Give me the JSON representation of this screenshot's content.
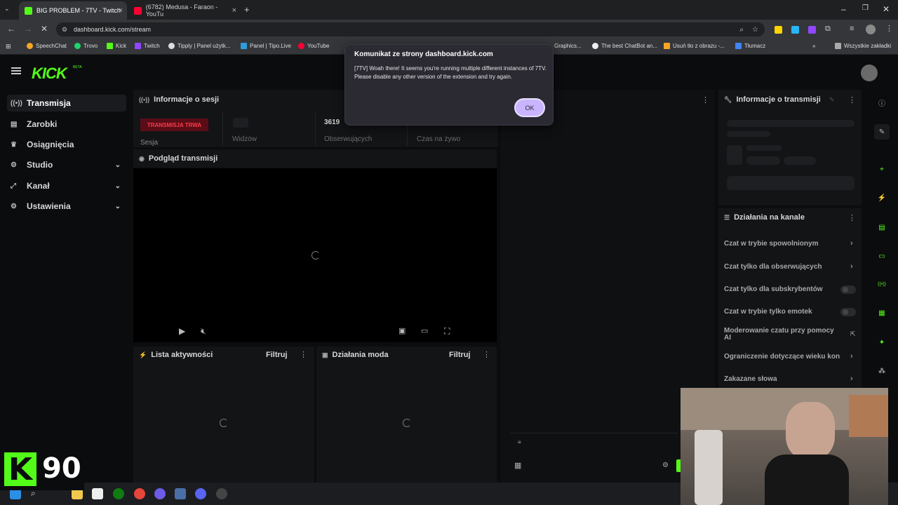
{
  "browser": {
    "tabs": [
      {
        "title": "BIG PROBLEM - 7TV - Twitch",
        "active": true
      },
      {
        "title": "(6782) Medusa - Faraon - YouTu",
        "active": false
      }
    ],
    "url": "dashboard.kick.com/stream",
    "bookmarks": [
      "SpeechChat",
      "Trovo",
      "Kick",
      "Twitch",
      "Tipply | Panel użytk...",
      "Panel | Tipo.Live",
      "YouTube",
      "Graphics...",
      "The best ChatBot an...",
      "Usuń tło z obrazu -...",
      "Tłumacz"
    ],
    "bookmarks_folder": "Wszystkie zakładki"
  },
  "kick": {
    "logo": "KICK",
    "beta": "BETA",
    "sidebar": [
      {
        "label": "Transmisja",
        "icon": "broadcast-icon",
        "active": true
      },
      {
        "label": "Zarobki",
        "icon": "wallet-icon"
      },
      {
        "label": "Osiągnięcia",
        "icon": "trophy-icon"
      },
      {
        "label": "Studio",
        "icon": "studio-icon",
        "expandable": true
      },
      {
        "label": "Kanał",
        "icon": "channel-icon",
        "expandable": true
      },
      {
        "label": "Ustawienia",
        "icon": "gear-icon",
        "expandable": true
      }
    ],
    "session": {
      "title": "Informacje o sesji",
      "live_badge": "TRANSMISJA TRWA",
      "session_label": "Sesja",
      "viewers_label": "Widzów",
      "followers_value": "3619",
      "followers_label": "Obserwujących",
      "live_time_label": "Czas na żywo"
    },
    "preview": {
      "title": "Podgląd transmisji"
    },
    "activity": {
      "title": "Lista aktywności",
      "filter": "Filtruj"
    },
    "mod": {
      "title": "Działania moda",
      "filter": "Filtruj"
    },
    "stream_info": {
      "title": "Informacje o transmisji"
    },
    "channel_actions": {
      "title": "Działania na kanale",
      "items": [
        {
          "label": "Czat w trybie spowolnionym",
          "type": "link"
        },
        {
          "label": "Czat tylko dla obserwujących",
          "type": "link"
        },
        {
          "label": "Czat tylko dla subskrybentów",
          "type": "toggle"
        },
        {
          "label": "Czat w trybie tylko emotek",
          "type": "toggle"
        },
        {
          "label": "Moderowanie czatu przy pomocy AI",
          "type": "external"
        },
        {
          "label": "Ograniczenie dotyczące wieku kon",
          "type": "link"
        },
        {
          "label": "Zakazane słowa",
          "type": "link"
        }
      ]
    }
  },
  "dialog": {
    "title": "Komunikat ze strony dashboard.kick.com",
    "message": "[7TV] Woah there! It seems you're running multiple different instances of 7TV. Please disable any other version of the extension and try again.",
    "ok": "OK"
  },
  "overlay": {
    "badge_letter": "K",
    "badge_number": "90"
  },
  "colors": {
    "kick_green": "#53fc18",
    "live_red": "#ff3a4d",
    "dialog_bg": "#2b2a33",
    "ok_button": "#c9b4ff"
  }
}
